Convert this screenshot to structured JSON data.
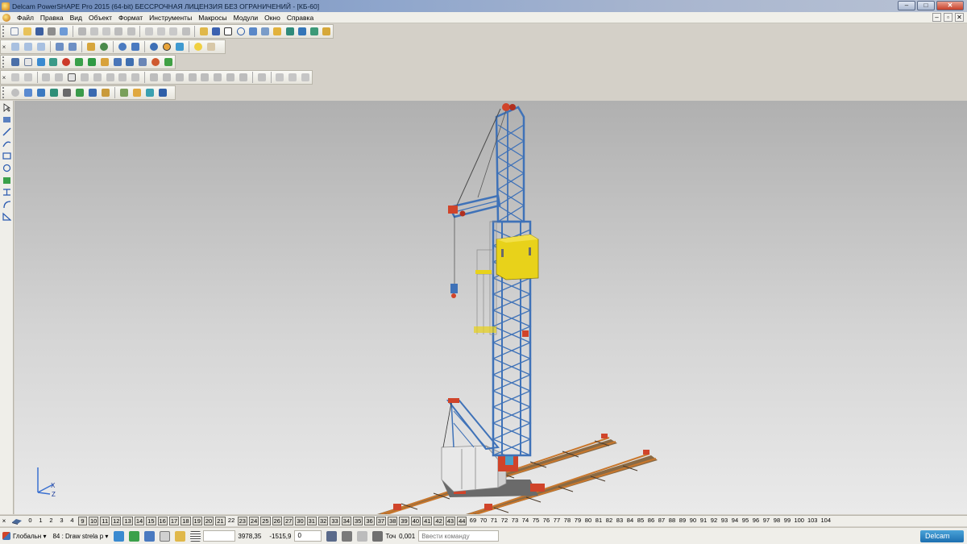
{
  "window": {
    "title": "Delcam PowerSHAPE Pro 2015 (64-bit) БЕССРОЧНАЯ ЛИЦЕНЗИЯ БЕЗ ОГРАНИЧЕНИЙ - [КБ-60]",
    "controls": [
      "–",
      "□",
      "✕"
    ]
  },
  "menu": {
    "items": [
      "Файл",
      "Правка",
      "Вид",
      "Объект",
      "Формат",
      "Инструменты",
      "Макросы",
      "Модули",
      "Окно",
      "Справка"
    ],
    "doc_controls": [
      "–",
      "▫",
      "✕"
    ]
  },
  "toolbars": {
    "close_glyph": "×"
  },
  "levels": {
    "items": [
      {
        "n": "0",
        "boxed": false
      },
      {
        "n": "1",
        "boxed": false
      },
      {
        "n": "2",
        "boxed": false
      },
      {
        "n": "3",
        "boxed": false
      },
      {
        "n": "4",
        "boxed": false
      },
      {
        "n": "9",
        "boxed": true
      },
      {
        "n": "10",
        "boxed": true
      },
      {
        "n": "11",
        "boxed": true
      },
      {
        "n": "12",
        "boxed": true
      },
      {
        "n": "13",
        "boxed": true
      },
      {
        "n": "14",
        "boxed": true
      },
      {
        "n": "15",
        "boxed": true
      },
      {
        "n": "16",
        "boxed": true
      },
      {
        "n": "17",
        "boxed": true
      },
      {
        "n": "18",
        "boxed": true
      },
      {
        "n": "19",
        "boxed": true
      },
      {
        "n": "20",
        "boxed": true
      },
      {
        "n": "21",
        "boxed": true
      },
      {
        "n": "22",
        "boxed": false
      },
      {
        "n": "23",
        "boxed": true
      },
      {
        "n": "24",
        "boxed": true
      },
      {
        "n": "25",
        "boxed": true
      },
      {
        "n": "26",
        "boxed": true
      },
      {
        "n": "27",
        "boxed": true
      },
      {
        "n": "30",
        "boxed": true
      },
      {
        "n": "31",
        "boxed": true
      },
      {
        "n": "32",
        "boxed": true
      },
      {
        "n": "33",
        "boxed": true
      },
      {
        "n": "34",
        "boxed": true
      },
      {
        "n": "35",
        "boxed": true
      },
      {
        "n": "36",
        "boxed": true
      },
      {
        "n": "37",
        "boxed": true
      },
      {
        "n": "38",
        "boxed": true
      },
      {
        "n": "39",
        "boxed": true
      },
      {
        "n": "40",
        "boxed": true
      },
      {
        "n": "41",
        "boxed": true
      },
      {
        "n": "42",
        "boxed": true
      },
      {
        "n": "43",
        "boxed": true
      },
      {
        "n": "44",
        "boxed": true
      },
      {
        "n": "69",
        "boxed": false
      },
      {
        "n": "70",
        "boxed": false
      },
      {
        "n": "71",
        "boxed": false
      },
      {
        "n": "72",
        "boxed": false
      },
      {
        "n": "73",
        "boxed": false
      },
      {
        "n": "74",
        "boxed": false
      },
      {
        "n": "75",
        "boxed": false
      },
      {
        "n": "76",
        "boxed": false
      },
      {
        "n": "77",
        "boxed": false
      },
      {
        "n": "78",
        "boxed": false
      },
      {
        "n": "79",
        "boxed": false
      },
      {
        "n": "80",
        "boxed": false
      },
      {
        "n": "81",
        "boxed": false
      },
      {
        "n": "82",
        "boxed": false
      },
      {
        "n": "83",
        "boxed": false
      },
      {
        "n": "84",
        "boxed": false
      },
      {
        "n": "85",
        "boxed": false
      },
      {
        "n": "86",
        "boxed": false
      },
      {
        "n": "87",
        "boxed": false
      },
      {
        "n": "88",
        "boxed": false
      },
      {
        "n": "89",
        "boxed": false
      },
      {
        "n": "90",
        "boxed": false
      },
      {
        "n": "91",
        "boxed": false
      },
      {
        "n": "92",
        "boxed": false
      },
      {
        "n": "93",
        "boxed": false
      },
      {
        "n": "94",
        "boxed": false
      },
      {
        "n": "95",
        "boxed": false
      },
      {
        "n": "96",
        "boxed": false
      },
      {
        "n": "97",
        "boxed": false
      },
      {
        "n": "98",
        "boxed": false
      },
      {
        "n": "99",
        "boxed": false
      },
      {
        "n": "100",
        "boxed": false
      },
      {
        "n": "103",
        "boxed": false
      },
      {
        "n": "104",
        "boxed": false
      }
    ]
  },
  "status": {
    "workplane": "Глобальн",
    "workplane_arrow": "▾",
    "level_select": "84 : Draw strela p",
    "level_arrow": "▾",
    "coord_x": "3978,35",
    "coord_y": "-1515,9",
    "coord_z": "0",
    "tolerance_label": "Точ",
    "tolerance_value": "0,001",
    "command_placeholder": "Ввести команду",
    "brand": "Delcam"
  },
  "axis": {
    "x_label": "X",
    "z_label": "Z"
  },
  "colors": {
    "crane_blue": "#3f72b8",
    "cab_yellow": "#e8d21a",
    "accent_red": "#d0442a",
    "rail_orange": "#c9772c"
  }
}
